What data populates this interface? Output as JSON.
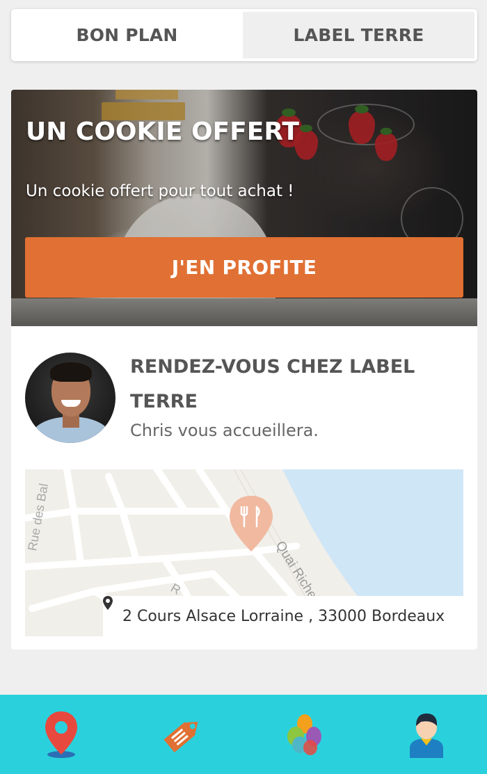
{
  "tabs": [
    {
      "label": "BON PLAN",
      "active": true
    },
    {
      "label": "LABEL TERRE",
      "active": false
    }
  ],
  "offer": {
    "title": "UN COOKIE OFFERT",
    "subtitle": "Un cookie offert pour tout achat !",
    "cta_label": "J'EN PROFITE",
    "cta_color": "#e07033"
  },
  "venue": {
    "title": "RENDEZ-VOUS CHEZ LABEL TERRE",
    "host_text": "Chris vous accueillera.",
    "address": "2 Cours Alsace Lorraine , 33000 Bordeaux"
  },
  "map": {
    "street_labels": [
      "Rue des Bal",
      "Quai Richelieu",
      "R"
    ],
    "marker_icon": "restaurant-fork-knife-icon",
    "water_color": "#cfe6f7"
  },
  "bottom_nav": {
    "background": "#2ad1dc",
    "items": [
      {
        "icon": "map-pin-icon"
      },
      {
        "icon": "price-tag-icon"
      },
      {
        "icon": "colorful-hands-icon"
      },
      {
        "icon": "user-profile-icon"
      }
    ]
  }
}
